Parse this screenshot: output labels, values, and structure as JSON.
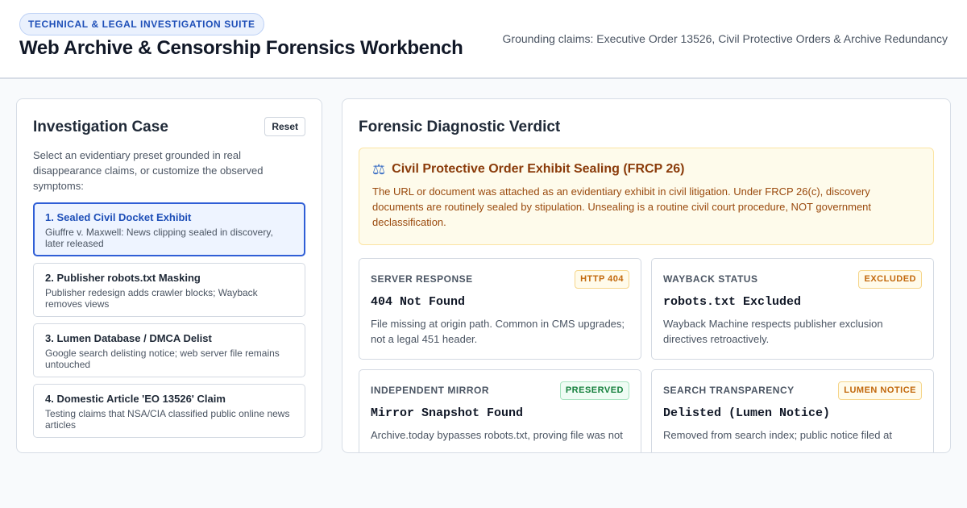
{
  "header": {
    "suite_badge": "TECHNICAL & LEGAL INVESTIGATION SUITE",
    "title": "Web Archive & Censorship Forensics Workbench",
    "grounding": "Grounding claims: Executive Order 13526, Civil Protective Orders & Archive Redundancy"
  },
  "case": {
    "title": "Investigation Case",
    "reset_label": "Reset",
    "intro": "Select an evidentiary preset grounded in real disappearance claims, or customize the observed symptoms:",
    "presets": [
      {
        "title": "1. Sealed Civil Docket Exhibit",
        "desc": "Giuffre v. Maxwell: News clipping sealed in discovery, later released",
        "active": true
      },
      {
        "title": "2. Publisher robots.txt Masking",
        "desc": "Publisher redesign adds crawler blocks; Wayback removes views",
        "active": false
      },
      {
        "title": "3. Lumen Database / DMCA Delist",
        "desc": "Google search delisting notice; web server file remains untouched",
        "active": false
      },
      {
        "title": "4. Domestic Article 'EO 13526' Claim",
        "desc": "Testing claims that NSA/CIA classified public online news articles",
        "active": false
      }
    ]
  },
  "verdict": {
    "title": "Forensic Diagnostic Verdict",
    "icon": "scales-icon",
    "alert_title": "Civil Protective Order Exhibit Sealing (FRCP 26)",
    "alert_body": "The URL or document was attached as an evidentiary exhibit in civil litigation. Under FRCP 26(c), discovery documents are routinely sealed by stipulation. Unsealing is a routine civil court procedure, NOT government declassification.",
    "cards": [
      {
        "label": "SERVER RESPONSE",
        "badge": "HTTP 404",
        "value": "404 Not Found",
        "desc": "File missing at origin path. Common in CMS upgrades; not a legal 451 header."
      },
      {
        "label": "WAYBACK STATUS",
        "badge": "EXCLUDED",
        "value": "robots.txt Excluded",
        "desc": "Wayback Machine respects publisher exclusion directives retroactively."
      },
      {
        "label": "INDEPENDENT MIRROR",
        "badge": "PRESERVED",
        "value": "Mirror Snapshot Found",
        "desc": "Archive.today bypasses robots.txt, proving file was not"
      },
      {
        "label": "SEARCH TRANSPARENCY",
        "badge": "LUMEN NOTICE",
        "value": "Delisted (Lumen Notice)",
        "desc": "Removed from search index; public notice filed at"
      }
    ]
  },
  "colors": {
    "accent": "#2f5ed6",
    "alert_bg": "#fefbeb",
    "alert_text": "#8a3b0a",
    "badge_amber": "#c2680c",
    "badge_green": "#15803d"
  }
}
